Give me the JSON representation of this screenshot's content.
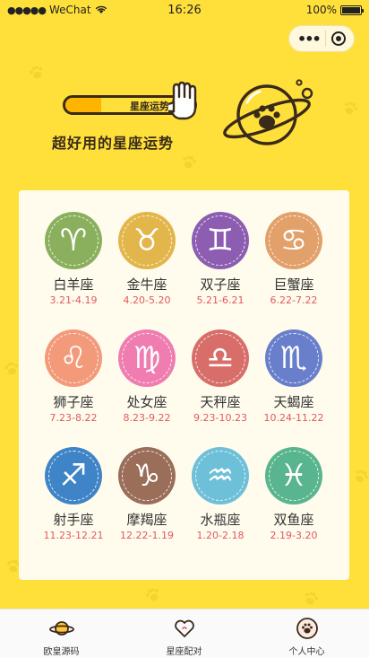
{
  "status_bar": {
    "carrier": "WeChat",
    "time": "16:26",
    "battery": "100%",
    "battery_level": 1.0
  },
  "capsule": {
    "more_icon": "more-dots-icon",
    "close_icon": "target-close-icon"
  },
  "banner": {
    "tag_text": "星座运势",
    "slogan": "超好用的星座运势"
  },
  "zodiacs": [
    {
      "name": "白羊座",
      "dates": "3.21-4.19",
      "glyph": "♈",
      "color": "#8AB05D"
    },
    {
      "name": "金牛座",
      "dates": "4.20-5.20",
      "glyph": "♉",
      "color": "#E3B64B"
    },
    {
      "name": "双子座",
      "dates": "5.21-6.21",
      "glyph": "♊",
      "color": "#8C5DB1"
    },
    {
      "name": "巨蟹座",
      "dates": "6.22-7.22",
      "glyph": "♋",
      "color": "#E2A06A"
    },
    {
      "name": "狮子座",
      "dates": "7.23-8.22",
      "glyph": "♌",
      "color": "#F39A7B"
    },
    {
      "name": "处女座",
      "dates": "8.23-9.22",
      "glyph": "♍",
      "color": "#F07DB0"
    },
    {
      "name": "天秤座",
      "dates": "9.23-10.23",
      "glyph": "♎",
      "color": "#D86E6A"
    },
    {
      "name": "天蝎座",
      "dates": "10.24-11.22",
      "glyph": "♏",
      "color": "#6A7FCB"
    },
    {
      "name": "射手座",
      "dates": "11.23-12.21",
      "glyph": "♐",
      "color": "#3E84C6"
    },
    {
      "name": "摩羯座",
      "dates": "12.22-1.19",
      "glyph": "♑",
      "color": "#9A6E59"
    },
    {
      "name": "水瓶座",
      "dates": "1.20-2.18",
      "glyph": "♒",
      "color": "#6EC0D8"
    },
    {
      "name": "双鱼座",
      "dates": "2.19-3.20",
      "glyph": "♓",
      "color": "#58B58D"
    }
  ],
  "tabs": [
    {
      "label": "欧皇源码",
      "icon": "planet-icon"
    },
    {
      "label": "星座配对",
      "icon": "heart-icon"
    },
    {
      "label": "个人中心",
      "icon": "paw-icon"
    }
  ],
  "colors": {
    "background": "#FFE03A",
    "card": "#FFFCEE",
    "date": "#E2585E",
    "dark": "#3A2A1A"
  }
}
